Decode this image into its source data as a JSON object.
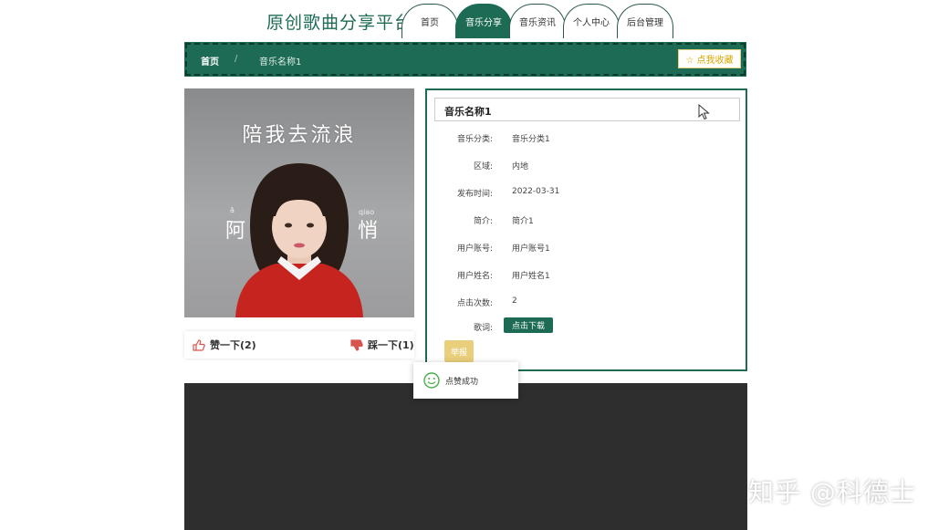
{
  "header": {
    "site_title": "原创歌曲分享平台",
    "nav": [
      {
        "label": "首页",
        "active": false
      },
      {
        "label": "音乐分享",
        "active": true
      },
      {
        "label": "音乐资讯",
        "active": false
      },
      {
        "label": "个人中心",
        "active": false
      },
      {
        "label": "后台管理",
        "active": false
      }
    ]
  },
  "breadcrumb": {
    "home": "首页",
    "separator": "/",
    "current": "音乐名称1",
    "favorite_button": "☆ 点我收藏"
  },
  "cover": {
    "title": "陪我去流浪",
    "left_char": "阿",
    "left_pinyin": "ā",
    "right_char": "悄",
    "right_pinyin": "qiao"
  },
  "votes": {
    "like_label": "赞一下(2)",
    "dislike_label": "踩一下(1)"
  },
  "detail": {
    "title": "音乐名称1",
    "fields": [
      {
        "label": "音乐分类:",
        "value": "音乐分类1"
      },
      {
        "label": "区域:",
        "value": "内地"
      },
      {
        "label": "发布时间:",
        "value": "2022-03-31"
      },
      {
        "label": "简介:",
        "value": "简介1"
      },
      {
        "label": "用户账号:",
        "value": "用户账号1"
      },
      {
        "label": "用户姓名:",
        "value": "用户姓名1"
      },
      {
        "label": "点击次数:",
        "value": "2"
      }
    ],
    "lyrics_label": "歌词:",
    "download_button": "点击下载",
    "action_button": "举报"
  },
  "toast": {
    "message": "点赞成功"
  },
  "watermark": "知乎 @科德士",
  "colors": {
    "primary": "#1d6b54",
    "footer": "#2d2e2d",
    "accent_yellow": "#e9cf7b",
    "vote_red": "#d9534f",
    "toast_green": "#4cae4c"
  }
}
